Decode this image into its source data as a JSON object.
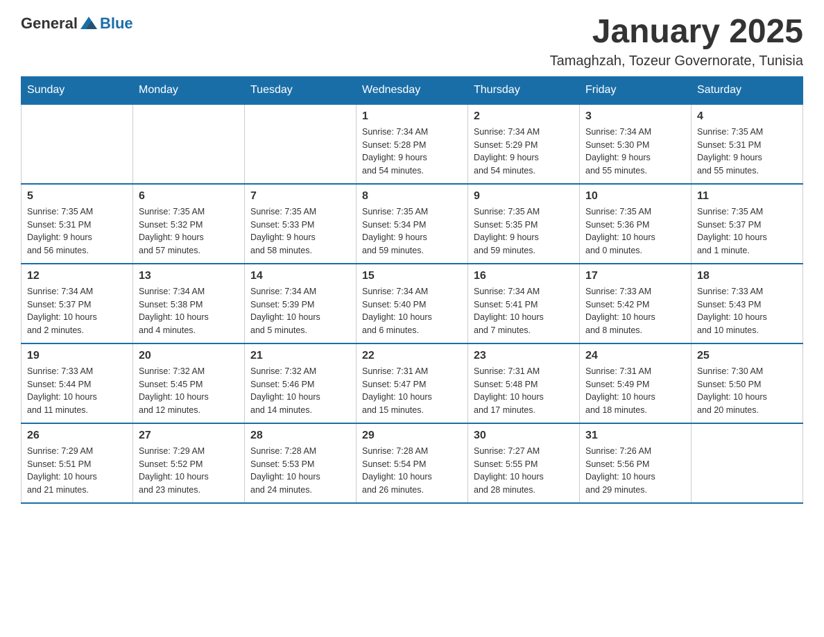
{
  "header": {
    "logo_general": "General",
    "logo_blue": "Blue",
    "month": "January 2025",
    "location": "Tamaghzah, Tozeur Governorate, Tunisia"
  },
  "weekdays": [
    "Sunday",
    "Monday",
    "Tuesday",
    "Wednesday",
    "Thursday",
    "Friday",
    "Saturday"
  ],
  "weeks": [
    [
      {
        "day": "",
        "info": ""
      },
      {
        "day": "",
        "info": ""
      },
      {
        "day": "",
        "info": ""
      },
      {
        "day": "1",
        "info": "Sunrise: 7:34 AM\nSunset: 5:28 PM\nDaylight: 9 hours\nand 54 minutes."
      },
      {
        "day": "2",
        "info": "Sunrise: 7:34 AM\nSunset: 5:29 PM\nDaylight: 9 hours\nand 54 minutes."
      },
      {
        "day": "3",
        "info": "Sunrise: 7:34 AM\nSunset: 5:30 PM\nDaylight: 9 hours\nand 55 minutes."
      },
      {
        "day": "4",
        "info": "Sunrise: 7:35 AM\nSunset: 5:31 PM\nDaylight: 9 hours\nand 55 minutes."
      }
    ],
    [
      {
        "day": "5",
        "info": "Sunrise: 7:35 AM\nSunset: 5:31 PM\nDaylight: 9 hours\nand 56 minutes."
      },
      {
        "day": "6",
        "info": "Sunrise: 7:35 AM\nSunset: 5:32 PM\nDaylight: 9 hours\nand 57 minutes."
      },
      {
        "day": "7",
        "info": "Sunrise: 7:35 AM\nSunset: 5:33 PM\nDaylight: 9 hours\nand 58 minutes."
      },
      {
        "day": "8",
        "info": "Sunrise: 7:35 AM\nSunset: 5:34 PM\nDaylight: 9 hours\nand 59 minutes."
      },
      {
        "day": "9",
        "info": "Sunrise: 7:35 AM\nSunset: 5:35 PM\nDaylight: 9 hours\nand 59 minutes."
      },
      {
        "day": "10",
        "info": "Sunrise: 7:35 AM\nSunset: 5:36 PM\nDaylight: 10 hours\nand 0 minutes."
      },
      {
        "day": "11",
        "info": "Sunrise: 7:35 AM\nSunset: 5:37 PM\nDaylight: 10 hours\nand 1 minute."
      }
    ],
    [
      {
        "day": "12",
        "info": "Sunrise: 7:34 AM\nSunset: 5:37 PM\nDaylight: 10 hours\nand 2 minutes."
      },
      {
        "day": "13",
        "info": "Sunrise: 7:34 AM\nSunset: 5:38 PM\nDaylight: 10 hours\nand 4 minutes."
      },
      {
        "day": "14",
        "info": "Sunrise: 7:34 AM\nSunset: 5:39 PM\nDaylight: 10 hours\nand 5 minutes."
      },
      {
        "day": "15",
        "info": "Sunrise: 7:34 AM\nSunset: 5:40 PM\nDaylight: 10 hours\nand 6 minutes."
      },
      {
        "day": "16",
        "info": "Sunrise: 7:34 AM\nSunset: 5:41 PM\nDaylight: 10 hours\nand 7 minutes."
      },
      {
        "day": "17",
        "info": "Sunrise: 7:33 AM\nSunset: 5:42 PM\nDaylight: 10 hours\nand 8 minutes."
      },
      {
        "day": "18",
        "info": "Sunrise: 7:33 AM\nSunset: 5:43 PM\nDaylight: 10 hours\nand 10 minutes."
      }
    ],
    [
      {
        "day": "19",
        "info": "Sunrise: 7:33 AM\nSunset: 5:44 PM\nDaylight: 10 hours\nand 11 minutes."
      },
      {
        "day": "20",
        "info": "Sunrise: 7:32 AM\nSunset: 5:45 PM\nDaylight: 10 hours\nand 12 minutes."
      },
      {
        "day": "21",
        "info": "Sunrise: 7:32 AM\nSunset: 5:46 PM\nDaylight: 10 hours\nand 14 minutes."
      },
      {
        "day": "22",
        "info": "Sunrise: 7:31 AM\nSunset: 5:47 PM\nDaylight: 10 hours\nand 15 minutes."
      },
      {
        "day": "23",
        "info": "Sunrise: 7:31 AM\nSunset: 5:48 PM\nDaylight: 10 hours\nand 17 minutes."
      },
      {
        "day": "24",
        "info": "Sunrise: 7:31 AM\nSunset: 5:49 PM\nDaylight: 10 hours\nand 18 minutes."
      },
      {
        "day": "25",
        "info": "Sunrise: 7:30 AM\nSunset: 5:50 PM\nDaylight: 10 hours\nand 20 minutes."
      }
    ],
    [
      {
        "day": "26",
        "info": "Sunrise: 7:29 AM\nSunset: 5:51 PM\nDaylight: 10 hours\nand 21 minutes."
      },
      {
        "day": "27",
        "info": "Sunrise: 7:29 AM\nSunset: 5:52 PM\nDaylight: 10 hours\nand 23 minutes."
      },
      {
        "day": "28",
        "info": "Sunrise: 7:28 AM\nSunset: 5:53 PM\nDaylight: 10 hours\nand 24 minutes."
      },
      {
        "day": "29",
        "info": "Sunrise: 7:28 AM\nSunset: 5:54 PM\nDaylight: 10 hours\nand 26 minutes."
      },
      {
        "day": "30",
        "info": "Sunrise: 7:27 AM\nSunset: 5:55 PM\nDaylight: 10 hours\nand 28 minutes."
      },
      {
        "day": "31",
        "info": "Sunrise: 7:26 AM\nSunset: 5:56 PM\nDaylight: 10 hours\nand 29 minutes."
      },
      {
        "day": "",
        "info": ""
      }
    ]
  ]
}
